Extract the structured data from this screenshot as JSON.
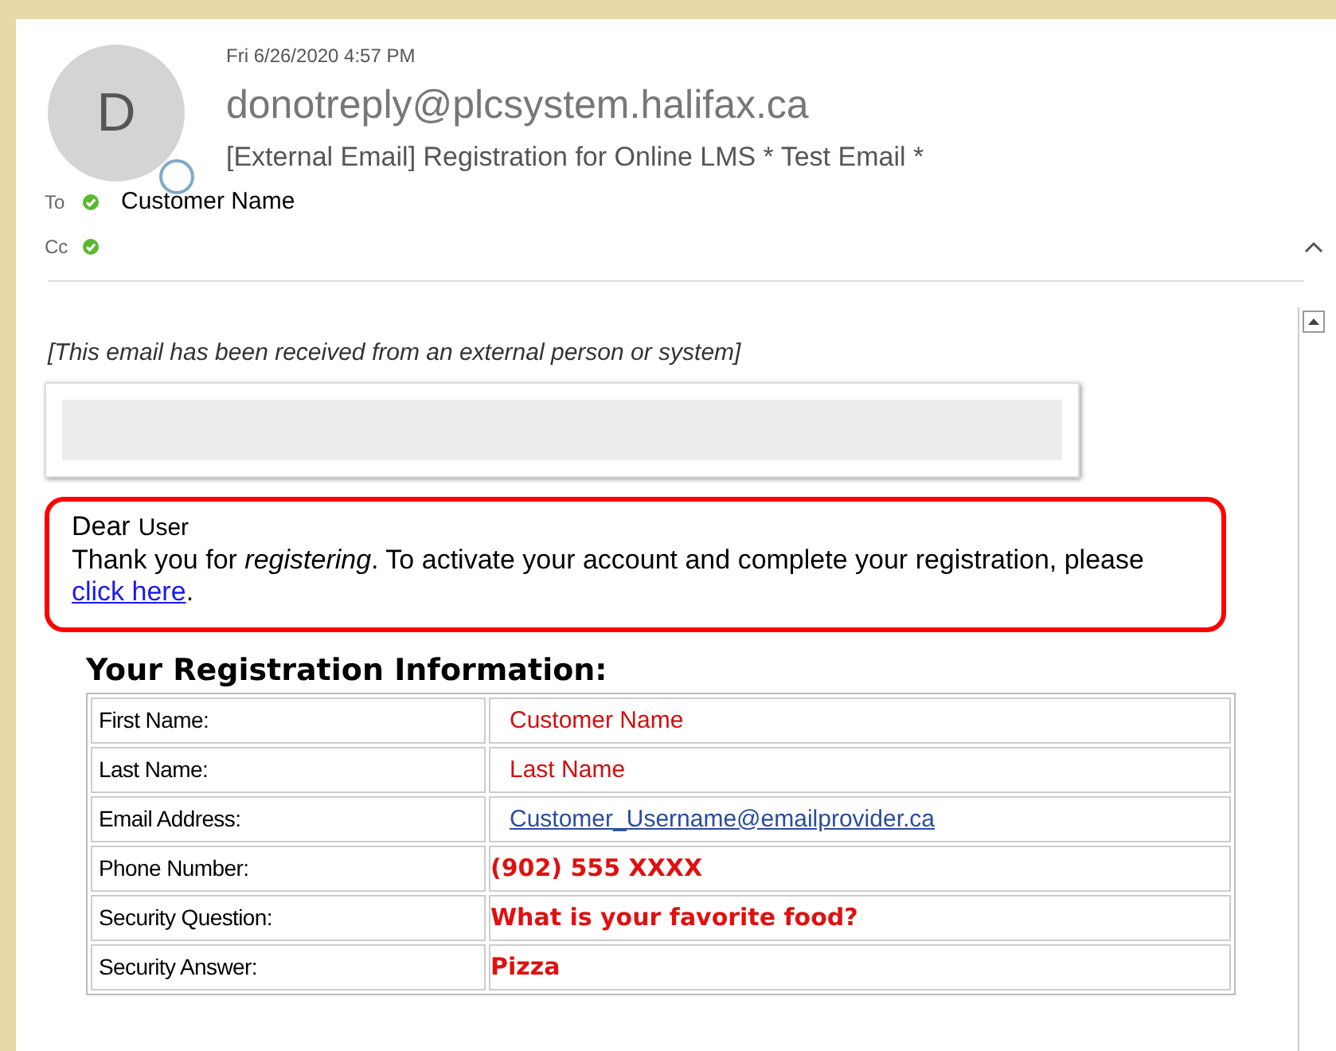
{
  "header": {
    "date": "Fri 6/26/2020 4:57 PM",
    "avatar_letter": "D",
    "sender": "donotreply@plcsystem.halifax.ca",
    "subject": "[External Email] Registration for Online LMS * Test Email *"
  },
  "recipients": [
    {
      "label": "To",
      "name": "Customer Name"
    },
    {
      "label": "Cc"
    }
  ],
  "body": {
    "notice": "[This email has been received from an external person or system]",
    "greeting": "Dear",
    "greeting_name": "User",
    "message": "Thank you for *registering*. To activate your account and complete your registration, please",
    "link": "click here",
    "link_end": ".",
    "table_title": "Your Registration Information:"
  },
  "rows": [
    {
      "label": "First Name:",
      "value": "Customer Name",
      "kind": "text"
    },
    {
      "label": "Last Name:",
      "value": "Last Name",
      "kind": "text"
    },
    {
      "label": "Email Address:",
      "value": "Customer_Username@emailprovider.ca",
      "kind": "link"
    },
    {
      "label": "Phone Number:",
      "value": "(902) 555 XXXX",
      "kind": "bold"
    },
    {
      "label": "Security Question:",
      "value": "What is your favorite food?",
      "kind": "bold"
    },
    {
      "label": "Security Answer:",
      "value": "Pizza",
      "kind": "bold"
    }
  ]
}
